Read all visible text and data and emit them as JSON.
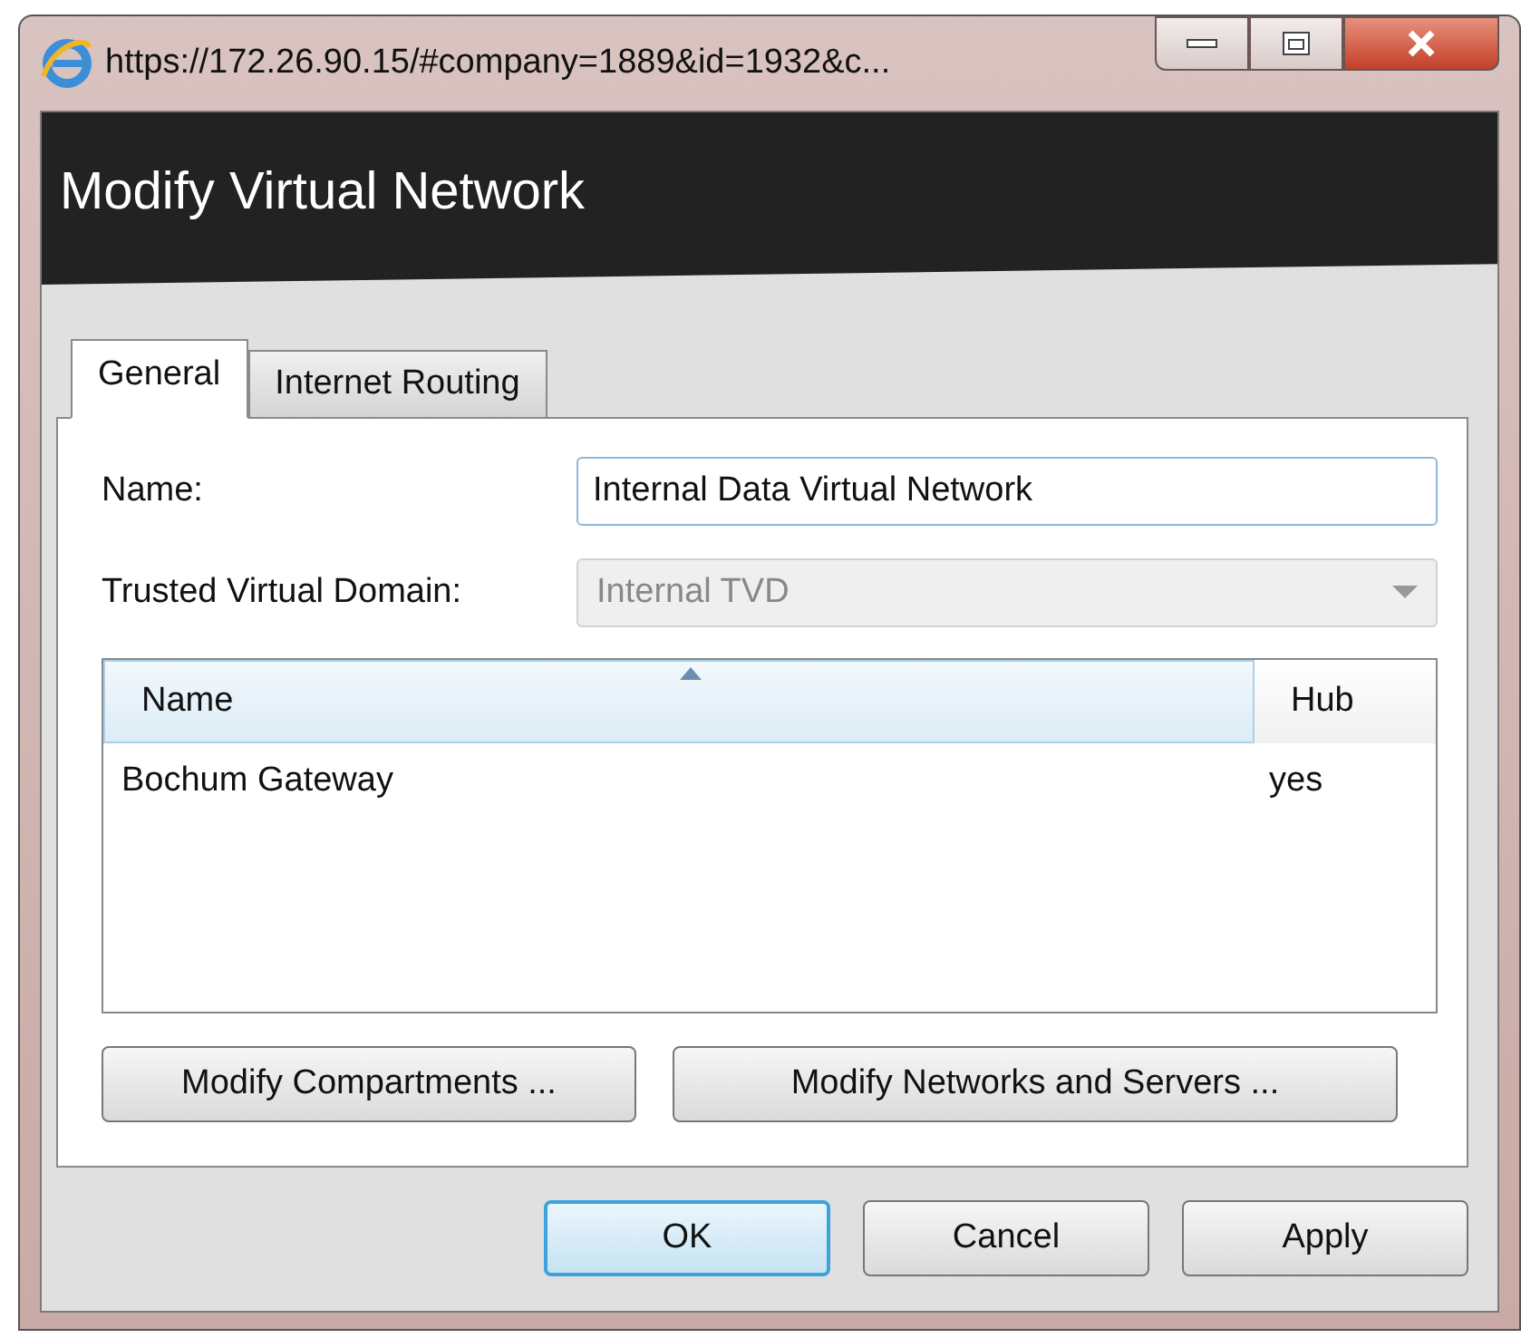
{
  "window": {
    "title": "https://172.26.90.15/#company=1889&id=1932&c..."
  },
  "dialog": {
    "title": "Modify Virtual Network"
  },
  "tabs": [
    {
      "label": "General",
      "selected": true
    },
    {
      "label": "Internet Routing",
      "selected": false
    }
  ],
  "form": {
    "name": {
      "label": "Name:",
      "value": "Internal Data Virtual Network"
    },
    "domain": {
      "label": "Trusted Virtual Domain:",
      "value": "Internal TVD",
      "disabled": true
    }
  },
  "table": {
    "columns": [
      {
        "label": "Name",
        "sorted": true
      },
      {
        "label": "Hub",
        "sorted": false
      }
    ],
    "rows": [
      {
        "name": "Bochum Gateway",
        "hub": "yes"
      }
    ]
  },
  "panel_buttons": [
    "Modify Compartments ...",
    "Modify Networks and Servers ..."
  ],
  "buttons": [
    {
      "label": "OK",
      "default": true
    },
    {
      "label": "Cancel",
      "default": false
    },
    {
      "label": "Apply",
      "default": false
    }
  ]
}
